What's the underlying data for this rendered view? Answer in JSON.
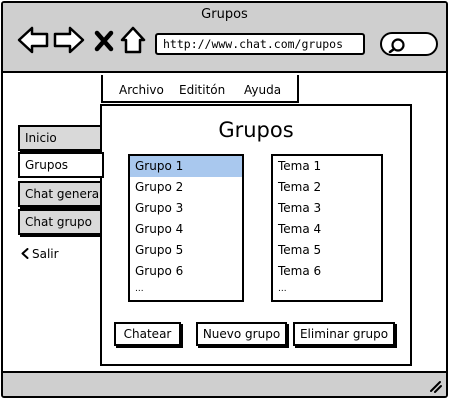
{
  "window": {
    "title": "Grupos"
  },
  "browser": {
    "url": "http://www.chat.com/grupos",
    "icons": [
      "back-icon",
      "forward-icon",
      "close-icon",
      "home-icon",
      "search-icon"
    ]
  },
  "menu": {
    "items": [
      "Archivo",
      "Edititón",
      "Ayuda"
    ]
  },
  "sidebar": {
    "tabs": [
      "Inicio",
      "Grupos",
      "Chat general",
      "Chat grupo"
    ],
    "active": "Grupos",
    "exit_label": "Salir"
  },
  "panel": {
    "title": "Grupos",
    "groups": [
      "Grupo 1",
      "Grupo 2",
      "Grupo 3",
      "Grupo 4",
      "Grupo 5",
      "Grupo 6",
      "..."
    ],
    "selected_group": "Grupo 1",
    "topics": [
      "Tema 1",
      "Tema 2",
      "Tema 3",
      "Tema 4",
      "Tema 5",
      "Tema 6",
      "..."
    ],
    "buttons": {
      "chat": "Chatear",
      "new_group": "Nuevo grupo",
      "delete_group": "Eliminar grupo"
    }
  },
  "colors": {
    "chrome": "#cfcfcf",
    "selection": "#a9c8ee",
    "inactive_tab": "#d9d9d9"
  }
}
